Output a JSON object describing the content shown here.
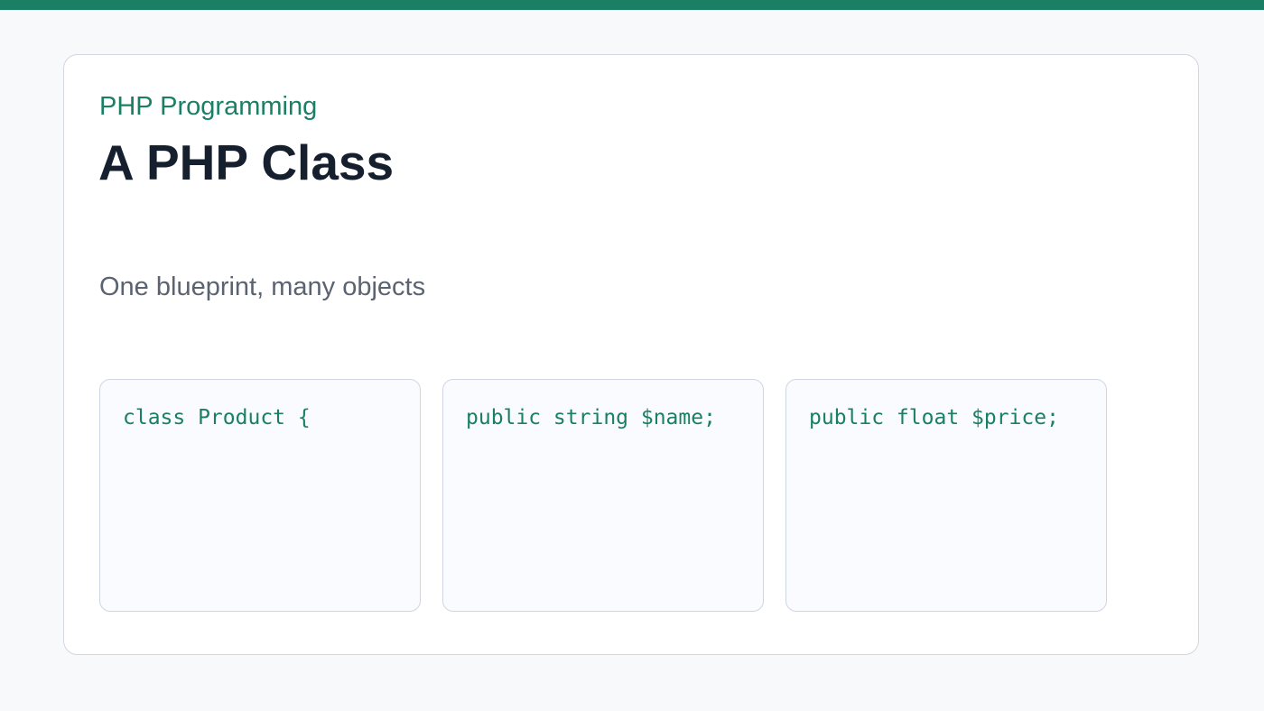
{
  "slide": {
    "eyebrow": "PHP Programming",
    "title": "A PHP Class",
    "subtitle": "One blueprint, many objects"
  },
  "code_blocks": [
    {
      "code": "class Product {"
    },
    {
      "code": "public string $name;"
    },
    {
      "code": "public float $price;"
    }
  ],
  "colors": {
    "accent": "#1a7f64",
    "title": "#161f2e",
    "subtitle": "#5b6371",
    "background": "#f8f9fb",
    "card": "#ffffff",
    "border": "#d1d6e0"
  }
}
